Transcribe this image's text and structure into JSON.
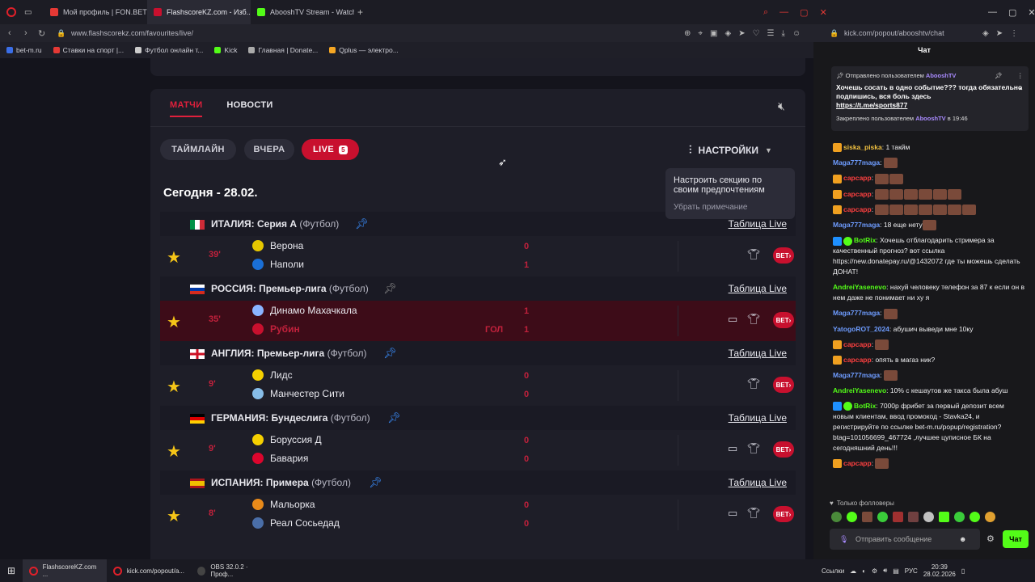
{
  "browser_left": {
    "tabs": [
      {
        "label": "Мой профиль | FON.BET",
        "color": "#e53935"
      },
      {
        "label": "FlashscoreKZ.com - Изб...",
        "color": "#c8102e"
      },
      {
        "label": "AbooshTV Stream - Watch",
        "color": "#53fc18"
      }
    ],
    "url": "www.flashscorekz.com/favourites/live/",
    "bookmarks": [
      {
        "label": "bet-m.ru",
        "color": "#3a6ee8"
      },
      {
        "label": "Ставки на спорт |...",
        "color": "#e53935"
      },
      {
        "label": "Футбол онлайн т...",
        "color": "#cccccc"
      },
      {
        "label": "Kick",
        "color": "#53fc18"
      },
      {
        "label": "Главная | Donate...",
        "color": "#aaaaaa"
      },
      {
        "label": "Qplus — электро...",
        "color": "#f5a623"
      }
    ]
  },
  "browser_right": {
    "url": "kick.com/popout/abooshtv/chat"
  },
  "flashscore": {
    "tabs": {
      "matches": "МАТЧИ",
      "news": "НОВОСТИ"
    },
    "filters": {
      "timeline": "ТАЙМЛАЙН",
      "yesterday": "ВЧЕРА",
      "live": "LIVE",
      "live_count": "5"
    },
    "settings_label": "НАСТРОЙКИ",
    "tooltip": {
      "text": "Настроить секцию по своим предпочтениям",
      "dismiss": "Убрать примечание"
    },
    "date_header": "Сегодня - 28.02.",
    "table_link": "Таблица Live",
    "sport": "(Футбол)",
    "leagues": [
      {
        "name": "ИТАЛИЯ: Серия А",
        "minute": "39'",
        "home": "Верона",
        "away": "Наполи",
        "home_score": "0",
        "away_score": "1",
        "goal": "",
        "flag": "it"
      },
      {
        "name": "РОССИЯ: Премьер-лига",
        "minute": "35'",
        "home": "Динамо Махачкала",
        "away": "Рубин",
        "home_score": "1",
        "away_score": "1",
        "goal": "ГОЛ",
        "flag": "ru"
      },
      {
        "name": "АНГЛИЯ: Премьер-лига",
        "minute": "9'",
        "home": "Лидс",
        "away": "Манчестер Сити",
        "home_score": "0",
        "away_score": "0",
        "goal": "",
        "flag": "en"
      },
      {
        "name": "ГЕРМАНИЯ: Бундеслига",
        "minute": "9'",
        "home": "Боруссия Д",
        "away": "Бавария",
        "home_score": "0",
        "away_score": "0",
        "goal": "",
        "flag": "de"
      },
      {
        "name": "ИСПАНИЯ: Примера",
        "minute": "8'",
        "home": "Мальорка",
        "away": "Реал Сосьедад",
        "home_score": "0",
        "away_score": "0",
        "goal": "",
        "flag": "es"
      }
    ],
    "bet_label": "BET"
  },
  "chat": {
    "title": "Чат",
    "pinned": {
      "sent_by": "Отправлено пользователем",
      "user": "AbooshTV",
      "text": "Хочешь сосать в одно событие??? тогда обязательно подпишись, вся боль здесь",
      "link": "https://t.me/sports877",
      "pinned_by": "Закреплено пользователем",
      "time": "в 19:46"
    },
    "messages": [
      {
        "user": "siska_piska",
        "color": "#f0c040",
        "text": "1 такйм",
        "emotes": 0
      },
      {
        "user": "Maga777maga",
        "color": "#6e9cff",
        "text": "",
        "emotes": 1
      },
      {
        "user": "сарсарр",
        "color": "#ff4040",
        "text": "",
        "emotes": 2
      },
      {
        "user": "сарсарр",
        "color": "#ff4040",
        "text": "",
        "emotes": 6
      },
      {
        "user": "сарсарр",
        "color": "#ff4040",
        "text": "",
        "emotes": 7
      },
      {
        "user": "Maga777maga",
        "color": "#6e9cff",
        "text": "18 еще нету",
        "emotes": 1
      },
      {
        "user": "BotRix",
        "color": "#53fc18",
        "text": "Хочешь отблагодарить стримера за качественный прогноз? вот ссылка https://new.donatepay.ru/@1432072 где ты можешь сделать ДОНАТ!",
        "emotes": 0
      },
      {
        "user": "AndreiYasenevo",
        "color": "#53fc18",
        "text": "нахуй человеку телефон за 87 к если он в нем даже не понимает ни ху я",
        "emotes": 0
      },
      {
        "user": "Maga777maga",
        "color": "#6e9cff",
        "text": "",
        "emotes": 1
      },
      {
        "user": "YatogoROT_2024",
        "color": "#6e9cff",
        "text": "абушич выведи мне 10ку",
        "emotes": 0
      },
      {
        "user": "сарсарр",
        "color": "#ff4040",
        "text": "",
        "emotes": 1
      },
      {
        "user": "сарсарр",
        "color": "#ff4040",
        "text": "опять в магаз ник?",
        "emotes": 0
      },
      {
        "user": "Maga777maga",
        "color": "#6e9cff",
        "text": "",
        "emotes": 1
      },
      {
        "user": "AndreiYasenevo",
        "color": "#53fc18",
        "text": "10% с кешаутов же такса была абуш",
        "emotes": 0
      },
      {
        "user": "BotRix",
        "color": "#53fc18",
        "text": "7000р фрибет за первый депозит всем новым клиентам, ввод промокод - Stavka24, и регистрируйте по ссылке bet-m.ru/popup/registration?btag=101056699_467724 ,лучшее цуписное БК на сегодняшний день!!!",
        "emotes": 0
      },
      {
        "user": "сарсарр",
        "color": "#ff4040",
        "text": "",
        "emotes": 1
      }
    ],
    "followers_only": "Только фолловеры",
    "input_placeholder": "Отправить сообщение",
    "send_label": "Чат"
  },
  "taskbar": {
    "items": [
      "FlashscoreKZ.com ...",
      "kick.com/popout/a...",
      "OBS 32.0.2 · Проф..."
    ],
    "links": "Ссылки",
    "lang": "РУС",
    "time": "20:39",
    "date": "28.02.2026"
  }
}
